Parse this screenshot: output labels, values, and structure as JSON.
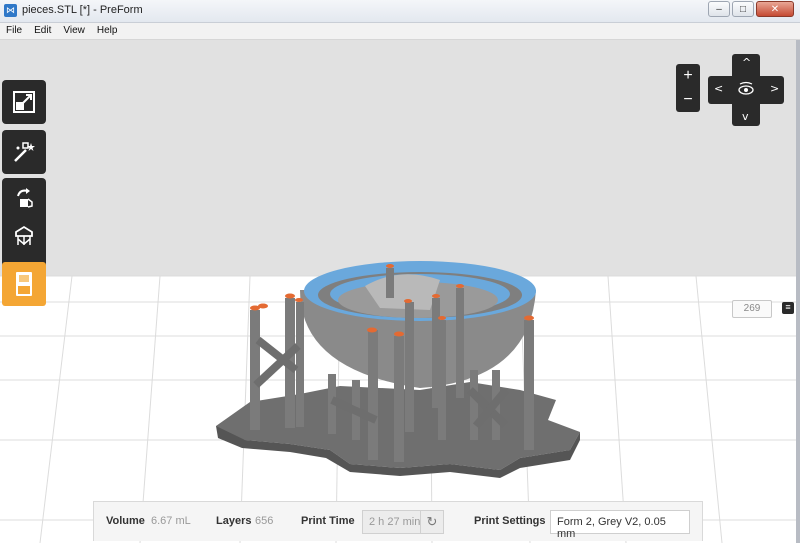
{
  "window": {
    "title": "pieces.STL [*] - PreForm",
    "app_icon": "preform-logo-icon",
    "controls": {
      "minimize": "–",
      "maximize": "□",
      "close": "✕"
    }
  },
  "menu": [
    "File",
    "Edit",
    "View",
    "Help"
  ],
  "left_toolbar": {
    "items": [
      "scale-icon",
      "auto-generate-icon",
      "orientation-icon",
      "supports-icon",
      "layout-icon"
    ],
    "print_button_icon": "print-icon"
  },
  "view_controls": {
    "zoom_in": "+",
    "zoom_out": "−",
    "nav_up": "^",
    "nav_down": "v",
    "nav_left": "<",
    "nav_right": ">",
    "nav_center_icon": "eye-rotate-icon"
  },
  "layer_slider": {
    "value": "269",
    "handle": "≡"
  },
  "info": {
    "volume_label": "Volume",
    "volume_value": "6.67 mL",
    "layers_label": "Layers",
    "layers_value": "656",
    "print_time_label": "Print Time",
    "print_time_value": "2 h 27 min",
    "print_settings_label": "Print Settings",
    "print_settings_value": "Form 2, Grey V2, 0.05 mm"
  },
  "colors": {
    "support": "#7b7b7b",
    "model_rim": "#6aa8dc",
    "contact_tip": "#e46a32",
    "accent": "#f4a634"
  }
}
